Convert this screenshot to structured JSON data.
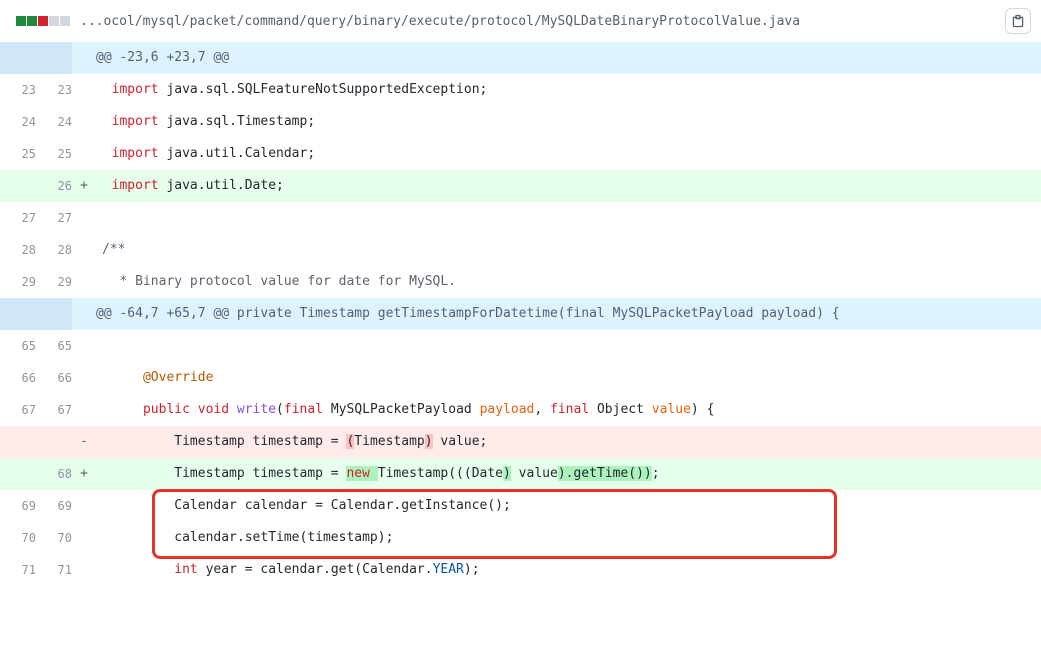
{
  "file": {
    "path": "...ocol/mysql/packet/command/query/binary/execute/protocol/MySQLDateBinaryProtocolValue.java",
    "diffstat": {
      "added": 2,
      "deleted": 1,
      "neutral": 2
    }
  },
  "hunks": [
    {
      "header": "@@ -23,6 +23,7 @@",
      "signature": ""
    },
    {
      "header": "@@ -64,7 +65,7 @@ ",
      "signature": "private Timestamp getTimestampForDatetime(final MySQLPacketPayload payload) {"
    }
  ],
  "lines": {
    "l23": "23",
    "l24": "24",
    "l25": "25",
    "l26": "26",
    "l27": "27",
    "l28": "28",
    "l29": "29",
    "l65": "65",
    "l66": "66",
    "l67": "67",
    "l68": "68",
    "l69": "69",
    "l70": "70",
    "l71": "71"
  },
  "code": {
    "import": "import",
    "r23a": " java.sql.SQLFeatureNotSupportedException;",
    "r24a": " java.sql.Timestamp;",
    "r25a": " java.util.Calendar;",
    "r26a": " java.util.Date;",
    "cmtOpen": "/**",
    "cmtLine": " * Binary protocol value for date for MySQL.",
    "override": "@Override",
    "public": "public",
    "void": "void",
    "write": "write",
    "final": "final",
    "payloadType": " MySQLPacketPayload ",
    "payload": "payload",
    "objectType": " Object ",
    "value": "value",
    "delCode_pre": "        Timestamp timestamp = ",
    "delCode_hl": "(",
    "delCode_mid": "Timestamp",
    "delCode_hl2": ")",
    "delCode_post": " value;",
    "addCode_pre": "        Timestamp timestamp = ",
    "addCode_new": "new ",
    "addCode_mid1": "Timestamp(((",
    "addCode_date": "Date",
    "addCode_mid2": ")",
    "addCode_mid3": " value",
    "addCode_tail": ").getTime())",
    "addCode_semi": ";",
    "r69": "        Calendar calendar = Calendar.getInstance();",
    "r70": "        calendar.setTime(timestamp);",
    "intkw": "int",
    "r71a": "        ",
    "r71b": " year = calendar.get(Calendar.",
    "year": "YEAR",
    "r71c": ");"
  },
  "markers": {
    "plus": "+",
    "minus": "-"
  }
}
